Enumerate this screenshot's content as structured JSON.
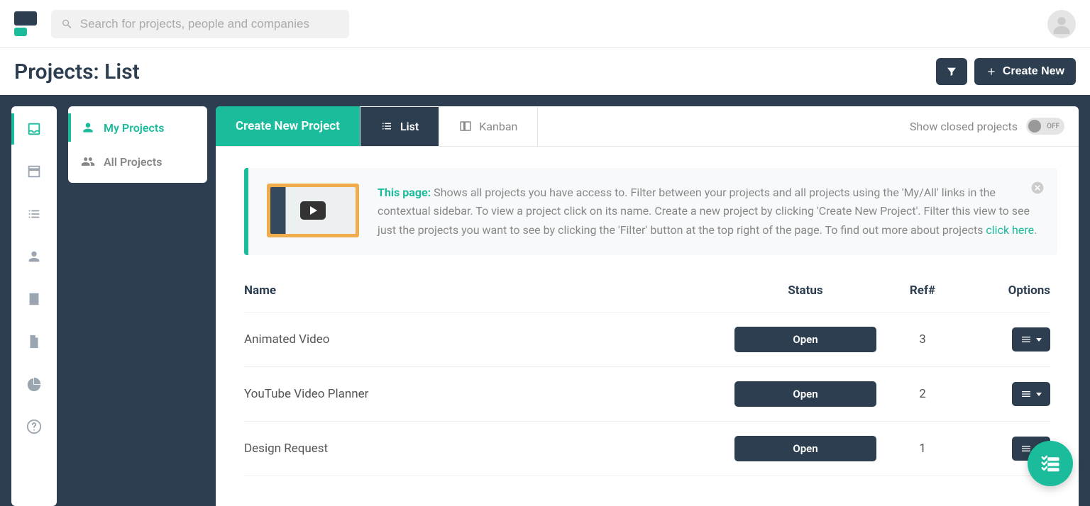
{
  "search": {
    "placeholder": "Search for projects, people and companies"
  },
  "page": {
    "title": "Projects: List"
  },
  "header_actions": {
    "create_new": "Create New"
  },
  "sub_sidebar": {
    "my_projects": "My Projects",
    "all_projects": "All Projects"
  },
  "tabs": {
    "create": "Create New Project",
    "list": "List",
    "kanban": "Kanban",
    "show_closed_label": "Show closed projects",
    "toggle_off": "OFF"
  },
  "info": {
    "prefix": "This page:",
    "body1": " Shows all projects you have access to. Filter between your projects and all projects using the 'My/All' links in the contextual sidebar. To view a project click on its name. Create a new project by clicking 'Create New Project'. Filter this view to see just the projects you want to see by clicking the 'Filter' button at the top right of the page. To find out more about projects ",
    "link": "click here",
    "after_link": "."
  },
  "table": {
    "headers": {
      "name": "Name",
      "status": "Status",
      "ref": "Ref#",
      "options": "Options"
    },
    "rows": [
      {
        "name": "Animated Video",
        "status": "Open",
        "ref": "3"
      },
      {
        "name": "YouTube Video Planner",
        "status": "Open",
        "ref": "2"
      },
      {
        "name": "Design Request",
        "status": "Open",
        "ref": "1"
      }
    ]
  }
}
